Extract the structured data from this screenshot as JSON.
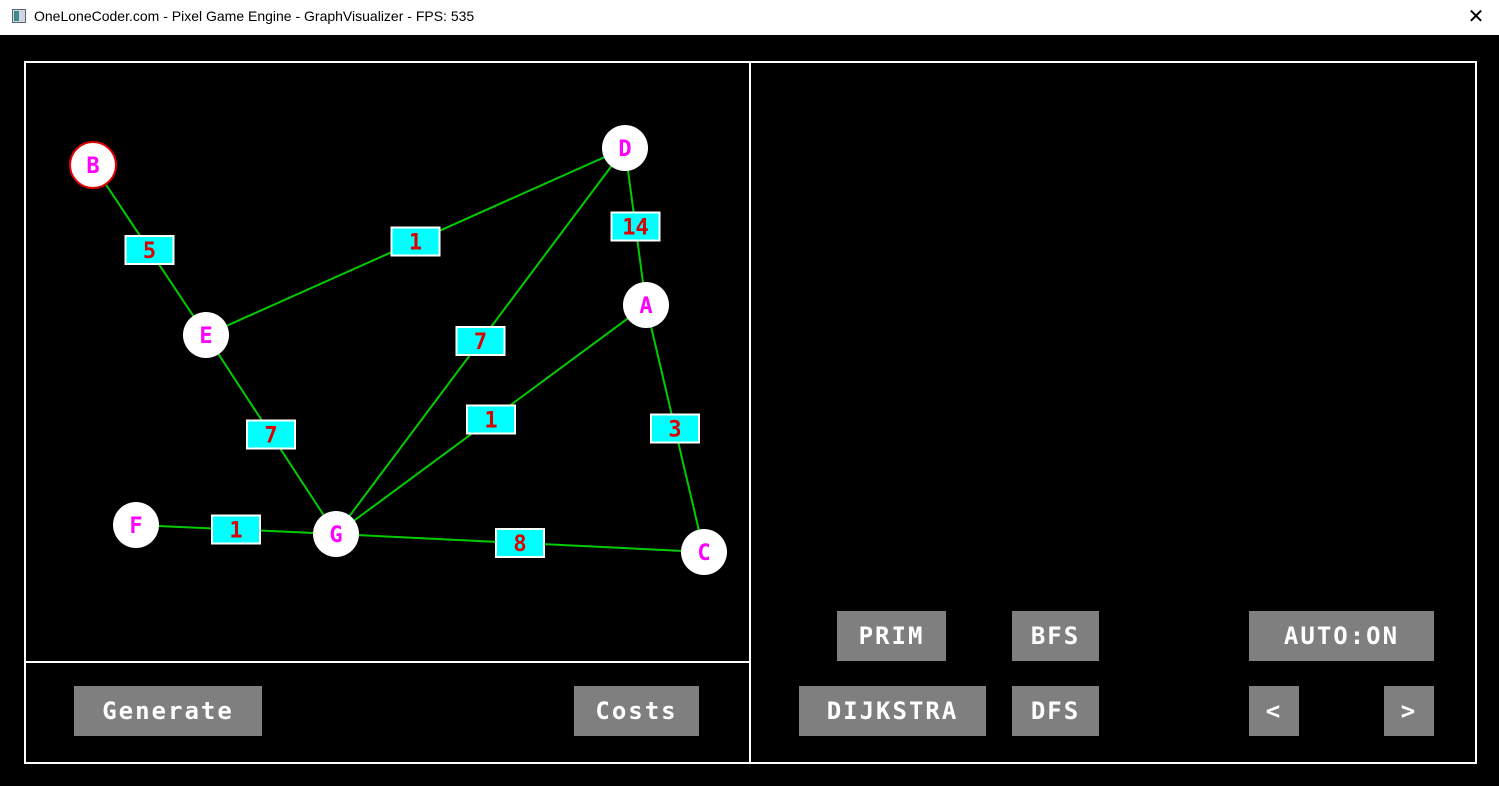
{
  "window": {
    "title": "OneLoneCoder.com - Pixel Game Engine - GraphVisualizer - FPS: 535",
    "icon": "app-window-icon",
    "close_label": "✕"
  },
  "colors": {
    "background": "#000000",
    "panel_border": "#ffffff",
    "edge": "#00cc00",
    "node_fill": "#ffffff",
    "node_label": "#ff00ff",
    "selected_node_border": "#dd0000",
    "cost_box_fill": "#00ffff",
    "cost_box_border": "#ffffff",
    "cost_text": "#dd0000",
    "button_fill": "#7f7f7f",
    "button_text": "#ffffff"
  },
  "graph": {
    "nodes": [
      {
        "id": "B",
        "label": "B",
        "selected": true
      },
      {
        "id": "D",
        "label": "D",
        "selected": false
      },
      {
        "id": "E",
        "label": "E",
        "selected": false
      },
      {
        "id": "A",
        "label": "A",
        "selected": false
      },
      {
        "id": "F",
        "label": "F",
        "selected": false
      },
      {
        "id": "G",
        "label": "G",
        "selected": false
      },
      {
        "id": "C",
        "label": "C",
        "selected": false
      }
    ],
    "edges": [
      {
        "from": "B",
        "to": "E",
        "cost": "5"
      },
      {
        "from": "E",
        "to": "D",
        "cost": "1"
      },
      {
        "from": "D",
        "to": "A",
        "cost": "14"
      },
      {
        "from": "D",
        "to": "G",
        "cost": "7"
      },
      {
        "from": "E",
        "to": "G",
        "cost": "7"
      },
      {
        "from": "A",
        "to": "G",
        "cost": "1"
      },
      {
        "from": "A",
        "to": "C",
        "cost": "3"
      },
      {
        "from": "F",
        "to": "G",
        "cost": "1"
      },
      {
        "from": "G",
        "to": "C",
        "cost": "8"
      }
    ]
  },
  "controls": {
    "generate": "Generate",
    "costs": "Costs",
    "prim": "PRIM",
    "bfs": "BFS",
    "auto": "AUTO:ON",
    "dijkstra": "DIJKSTRA",
    "dfs": "DFS",
    "prev": "<",
    "next": ">"
  }
}
